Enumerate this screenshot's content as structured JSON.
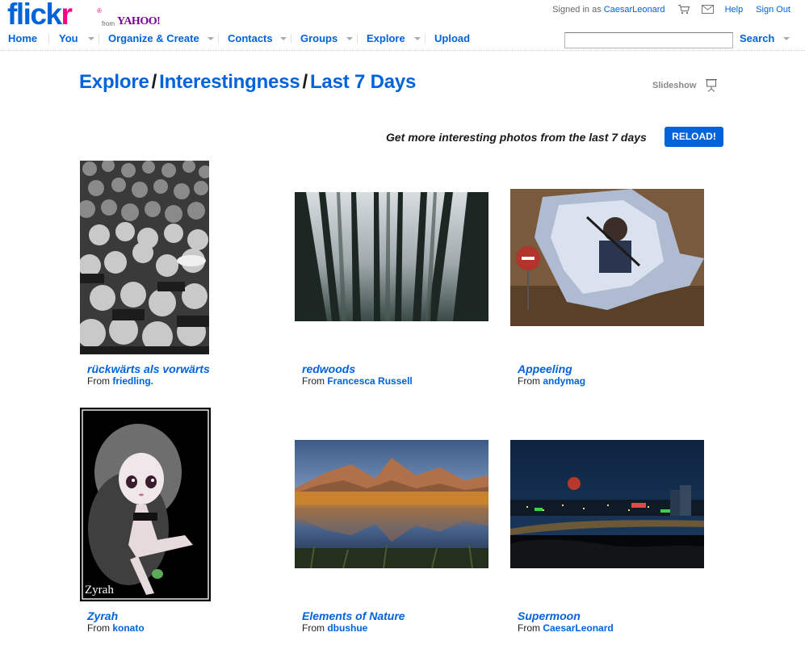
{
  "brand": {
    "logo_a": "flick",
    "logo_b": "r",
    "reg": "®",
    "from": "from",
    "yahoo": "YAHOO!"
  },
  "topbar": {
    "signed_in_as": "Signed in as",
    "username": "CaesarLeonard",
    "help": "Help",
    "sign_out": "Sign Out"
  },
  "nav": {
    "home": "Home",
    "you": "You",
    "organize": "Organize & Create",
    "contacts": "Contacts",
    "groups": "Groups",
    "explore": "Explore",
    "upload": "Upload",
    "search_label": "Search"
  },
  "search": {
    "value": ""
  },
  "breadcrumb": {
    "explore": "Explore",
    "interestingness": "Interestingness",
    "last7": "Last 7 Days",
    "slash": "/"
  },
  "slideshow_label": "Slideshow",
  "promo": {
    "text": "Get more interesting photos from the last 7 days",
    "reload": "RELOAD!"
  },
  "from_label": "From",
  "photos": [
    {
      "title": "rückwärts als vorwärts",
      "author": "friedling."
    },
    {
      "title": "redwoods",
      "author": "Francesca Russell"
    },
    {
      "title": "Appeeling",
      "author": "andymag"
    },
    {
      "title": "Zyrah",
      "author": "konato",
      "caption": "Zyrah"
    },
    {
      "title": "Elements of Nature",
      "author": "dbushue"
    },
    {
      "title": "Supermoon",
      "author": "CaesarLeonard"
    }
  ],
  "icons": {
    "cart": "cart-icon",
    "mail": "mail-icon",
    "slideshow": "slideshow-icon",
    "dropdown": "chevron-down-icon"
  },
  "colors": {
    "link_blue": "#0063dc",
    "flickr_pink": "#ff0084",
    "yahoo_purple": "#7b0099"
  }
}
